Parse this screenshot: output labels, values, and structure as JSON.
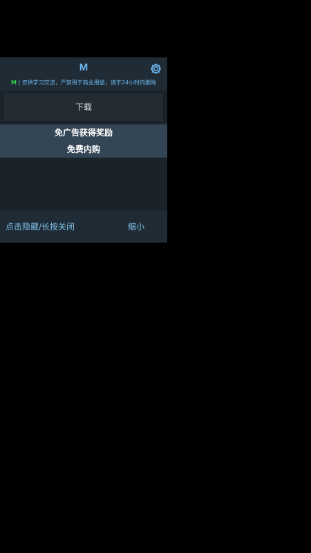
{
  "header": {
    "title": "M",
    "settings_icon": "gear-icon",
    "notice_brand": "M",
    "notice_text": " | 仅供学习交流，严禁用于商业用途，请于24小时内删除"
  },
  "main": {
    "download_label": "下载",
    "menu_items": [
      {
        "label": "免广告获得奖励"
      },
      {
        "label": "免费内购"
      }
    ]
  },
  "footer": {
    "hide_close_label": "点击隐藏/长按关闭",
    "minimize_label": "缩小"
  },
  "colors": {
    "accent": "#6cb8f0",
    "brand_green": "#35d04a",
    "panel_bg": "#1b232a",
    "section_bg": "#344555"
  }
}
